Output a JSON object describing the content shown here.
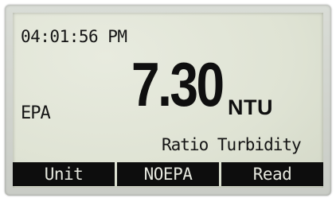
{
  "display": {
    "time": "04:01:56 PM",
    "mode": "EPA",
    "reading": "7.30",
    "unit": "NTU",
    "measurement": "Ratio Turbidity"
  },
  "softkeys": [
    {
      "label": "Unit"
    },
    {
      "label": "NOEPA"
    },
    {
      "label": "Read"
    }
  ],
  "colors": {
    "lcd_background": "#dfe3d4",
    "segment_text": "#141414",
    "softkey_bar": "#0d0d0d",
    "softkey_text": "#e6e8df"
  }
}
